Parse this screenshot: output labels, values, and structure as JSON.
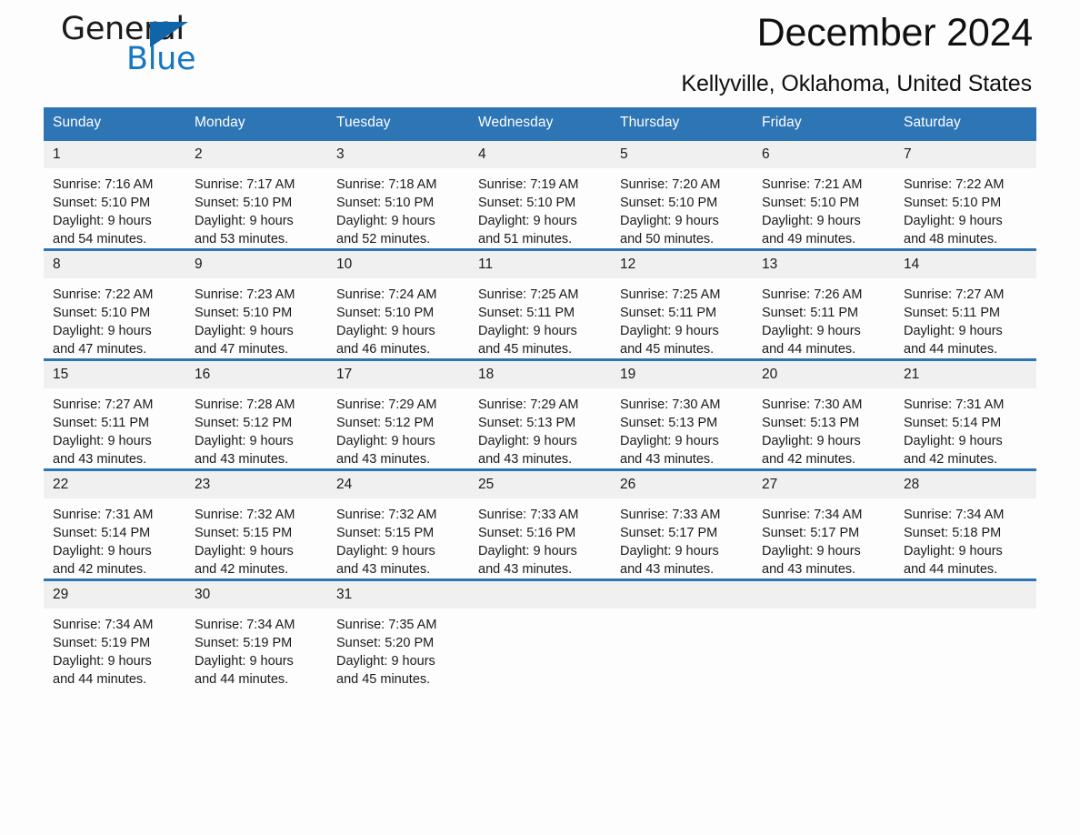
{
  "brand": {
    "name_part1": "General",
    "name_part2": "Blue",
    "accent_color": "#1577c4",
    "triangle_color": "#1064a8"
  },
  "header": {
    "title": "December 2024",
    "subtitle": "Kellyville, Oklahoma, United States",
    "header_bg_color": "#2e75b6"
  },
  "calendar": {
    "weekday_headers": [
      "Sunday",
      "Monday",
      "Tuesday",
      "Wednesday",
      "Thursday",
      "Friday",
      "Saturday"
    ],
    "weeks": [
      [
        {
          "day": "1",
          "sunrise": "Sunrise: 7:16 AM",
          "sunset": "Sunset: 5:10 PM",
          "daylight_line1": "Daylight: 9 hours",
          "daylight_line2": "and 54 minutes."
        },
        {
          "day": "2",
          "sunrise": "Sunrise: 7:17 AM",
          "sunset": "Sunset: 5:10 PM",
          "daylight_line1": "Daylight: 9 hours",
          "daylight_line2": "and 53 minutes."
        },
        {
          "day": "3",
          "sunrise": "Sunrise: 7:18 AM",
          "sunset": "Sunset: 5:10 PM",
          "daylight_line1": "Daylight: 9 hours",
          "daylight_line2": "and 52 minutes."
        },
        {
          "day": "4",
          "sunrise": "Sunrise: 7:19 AM",
          "sunset": "Sunset: 5:10 PM",
          "daylight_line1": "Daylight: 9 hours",
          "daylight_line2": "and 51 minutes."
        },
        {
          "day": "5",
          "sunrise": "Sunrise: 7:20 AM",
          "sunset": "Sunset: 5:10 PM",
          "daylight_line1": "Daylight: 9 hours",
          "daylight_line2": "and 50 minutes."
        },
        {
          "day": "6",
          "sunrise": "Sunrise: 7:21 AM",
          "sunset": "Sunset: 5:10 PM",
          "daylight_line1": "Daylight: 9 hours",
          "daylight_line2": "and 49 minutes."
        },
        {
          "day": "7",
          "sunrise": "Sunrise: 7:22 AM",
          "sunset": "Sunset: 5:10 PM",
          "daylight_line1": "Daylight: 9 hours",
          "daylight_line2": "and 48 minutes."
        }
      ],
      [
        {
          "day": "8",
          "sunrise": "Sunrise: 7:22 AM",
          "sunset": "Sunset: 5:10 PM",
          "daylight_line1": "Daylight: 9 hours",
          "daylight_line2": "and 47 minutes."
        },
        {
          "day": "9",
          "sunrise": "Sunrise: 7:23 AM",
          "sunset": "Sunset: 5:10 PM",
          "daylight_line1": "Daylight: 9 hours",
          "daylight_line2": "and 47 minutes."
        },
        {
          "day": "10",
          "sunrise": "Sunrise: 7:24 AM",
          "sunset": "Sunset: 5:10 PM",
          "daylight_line1": "Daylight: 9 hours",
          "daylight_line2": "and 46 minutes."
        },
        {
          "day": "11",
          "sunrise": "Sunrise: 7:25 AM",
          "sunset": "Sunset: 5:11 PM",
          "daylight_line1": "Daylight: 9 hours",
          "daylight_line2": "and 45 minutes."
        },
        {
          "day": "12",
          "sunrise": "Sunrise: 7:25 AM",
          "sunset": "Sunset: 5:11 PM",
          "daylight_line1": "Daylight: 9 hours",
          "daylight_line2": "and 45 minutes."
        },
        {
          "day": "13",
          "sunrise": "Sunrise: 7:26 AM",
          "sunset": "Sunset: 5:11 PM",
          "daylight_line1": "Daylight: 9 hours",
          "daylight_line2": "and 44 minutes."
        },
        {
          "day": "14",
          "sunrise": "Sunrise: 7:27 AM",
          "sunset": "Sunset: 5:11 PM",
          "daylight_line1": "Daylight: 9 hours",
          "daylight_line2": "and 44 minutes."
        }
      ],
      [
        {
          "day": "15",
          "sunrise": "Sunrise: 7:27 AM",
          "sunset": "Sunset: 5:11 PM",
          "daylight_line1": "Daylight: 9 hours",
          "daylight_line2": "and 43 minutes."
        },
        {
          "day": "16",
          "sunrise": "Sunrise: 7:28 AM",
          "sunset": "Sunset: 5:12 PM",
          "daylight_line1": "Daylight: 9 hours",
          "daylight_line2": "and 43 minutes."
        },
        {
          "day": "17",
          "sunrise": "Sunrise: 7:29 AM",
          "sunset": "Sunset: 5:12 PM",
          "daylight_line1": "Daylight: 9 hours",
          "daylight_line2": "and 43 minutes."
        },
        {
          "day": "18",
          "sunrise": "Sunrise: 7:29 AM",
          "sunset": "Sunset: 5:13 PM",
          "daylight_line1": "Daylight: 9 hours",
          "daylight_line2": "and 43 minutes."
        },
        {
          "day": "19",
          "sunrise": "Sunrise: 7:30 AM",
          "sunset": "Sunset: 5:13 PM",
          "daylight_line1": "Daylight: 9 hours",
          "daylight_line2": "and 43 minutes."
        },
        {
          "day": "20",
          "sunrise": "Sunrise: 7:30 AM",
          "sunset": "Sunset: 5:13 PM",
          "daylight_line1": "Daylight: 9 hours",
          "daylight_line2": "and 42 minutes."
        },
        {
          "day": "21",
          "sunrise": "Sunrise: 7:31 AM",
          "sunset": "Sunset: 5:14 PM",
          "daylight_line1": "Daylight: 9 hours",
          "daylight_line2": "and 42 minutes."
        }
      ],
      [
        {
          "day": "22",
          "sunrise": "Sunrise: 7:31 AM",
          "sunset": "Sunset: 5:14 PM",
          "daylight_line1": "Daylight: 9 hours",
          "daylight_line2": "and 42 minutes."
        },
        {
          "day": "23",
          "sunrise": "Sunrise: 7:32 AM",
          "sunset": "Sunset: 5:15 PM",
          "daylight_line1": "Daylight: 9 hours",
          "daylight_line2": "and 42 minutes."
        },
        {
          "day": "24",
          "sunrise": "Sunrise: 7:32 AM",
          "sunset": "Sunset: 5:15 PM",
          "daylight_line1": "Daylight: 9 hours",
          "daylight_line2": "and 43 minutes."
        },
        {
          "day": "25",
          "sunrise": "Sunrise: 7:33 AM",
          "sunset": "Sunset: 5:16 PM",
          "daylight_line1": "Daylight: 9 hours",
          "daylight_line2": "and 43 minutes."
        },
        {
          "day": "26",
          "sunrise": "Sunrise: 7:33 AM",
          "sunset": "Sunset: 5:17 PM",
          "daylight_line1": "Daylight: 9 hours",
          "daylight_line2": "and 43 minutes."
        },
        {
          "day": "27",
          "sunrise": "Sunrise: 7:34 AM",
          "sunset": "Sunset: 5:17 PM",
          "daylight_line1": "Daylight: 9 hours",
          "daylight_line2": "and 43 minutes."
        },
        {
          "day": "28",
          "sunrise": "Sunrise: 7:34 AM",
          "sunset": "Sunset: 5:18 PM",
          "daylight_line1": "Daylight: 9 hours",
          "daylight_line2": "and 44 minutes."
        }
      ],
      [
        {
          "day": "29",
          "sunrise": "Sunrise: 7:34 AM",
          "sunset": "Sunset: 5:19 PM",
          "daylight_line1": "Daylight: 9 hours",
          "daylight_line2": "and 44 minutes."
        },
        {
          "day": "30",
          "sunrise": "Sunrise: 7:34 AM",
          "sunset": "Sunset: 5:19 PM",
          "daylight_line1": "Daylight: 9 hours",
          "daylight_line2": "and 44 minutes."
        },
        {
          "day": "31",
          "sunrise": "Sunrise: 7:35 AM",
          "sunset": "Sunset: 5:20 PM",
          "daylight_line1": "Daylight: 9 hours",
          "daylight_line2": "and 45 minutes."
        },
        {
          "day": "",
          "sunrise": "",
          "sunset": "",
          "daylight_line1": "",
          "daylight_line2": ""
        },
        {
          "day": "",
          "sunrise": "",
          "sunset": "",
          "daylight_line1": "",
          "daylight_line2": ""
        },
        {
          "day": "",
          "sunrise": "",
          "sunset": "",
          "daylight_line1": "",
          "daylight_line2": ""
        },
        {
          "day": "",
          "sunrise": "",
          "sunset": "",
          "daylight_line1": "",
          "daylight_line2": ""
        }
      ]
    ]
  }
}
